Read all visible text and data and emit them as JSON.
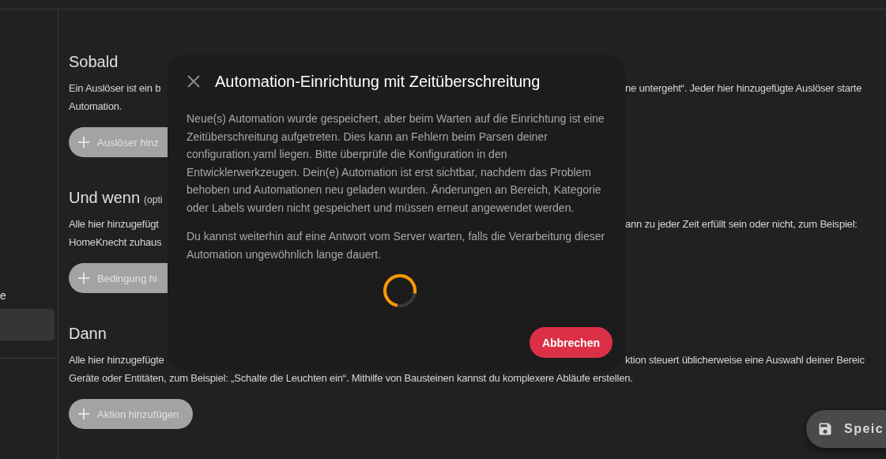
{
  "sidebar": {
    "items": [
      {
        "label": "e",
        "selected": false
      },
      {
        "selected": true
      }
    ]
  },
  "sections": [
    {
      "heading": "Sobald",
      "lines": [
        [
          "Ein Auslöser ist ein b",
          "ne untergeht“. Jeder hier hinzugefügte Auslöser starte"
        ],
        [
          "Automation."
        ]
      ],
      "button": "Auslöser hinz",
      "button_cut": true
    },
    {
      "heading": "Und wenn",
      "note": "(opti",
      "lines": [
        [
          "Alle hier hinzugefügt",
          "ann zu jeder Zeit erfüllt sein oder nicht, zum Beispiel:"
        ],
        [
          "HomeKnecht zuhaus"
        ]
      ],
      "button": "Bedingung hi",
      "button_cut": true
    },
    {
      "heading": "Dann",
      "lines": [
        [
          "Alle hier hinzugefügte",
          "ktion steuert üblicherweise eine Auswahl deiner Bereic"
        ],
        [
          "Geräte oder Entitäten, zum Beispiel: „Schalte die Leuchten ein“. Mithilfe von Bausteinen kannst du komplexere Abläufe erstellen."
        ]
      ],
      "button": "Aktion hinzufügen",
      "button_cut": false
    }
  ],
  "save_button": {
    "label": "Speic"
  },
  "dialog": {
    "title": "Automation-Einrichtung mit Zeitüberschreitung",
    "paragraphs": [
      "Neue(s) Automation wurde gespeichert, aber beim Warten auf die Einrichtung ist eine Zeitüberschreitung aufgetreten. Dies kann an Fehlern beim Parsen deiner configuration.yaml liegen. Bitte überprüfe die Konfiguration in den Entwicklerwerkzeugen. Dein(e) Automation ist erst sichtbar, nachdem das Problem behoben und Automationen neu geladen wurden. Änderungen an Bereich, Kategorie oder Labels wurden nicht gespeichert und müssen erneut angewendet werden.",
      "Du kannst weiterhin auf eine Antwort vom Server warten, falls die Verarbeitung dieser Automation ungewöhnlich lange dauert."
    ],
    "loading": true,
    "buttons": [
      {
        "label": "Abbrechen",
        "kind": "danger"
      }
    ]
  }
}
